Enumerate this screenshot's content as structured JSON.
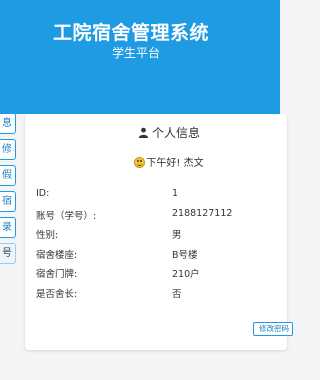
{
  "header": {
    "title": "工院宿舍管理系统",
    "subtitle": "学生平台",
    "color": "#1e9be2"
  },
  "sidebar": {
    "items": [
      {
        "label": "息"
      },
      {
        "label": "修"
      },
      {
        "label": "假"
      },
      {
        "label": "宿"
      },
      {
        "label": "录"
      },
      {
        "label": "号"
      }
    ]
  },
  "card": {
    "title": "个人信息",
    "title_icon": "user-icon",
    "greeting": "下午好!  杰文",
    "greeting_icon": "smile-icon",
    "fields": [
      {
        "label": "ID:",
        "value": "1"
      },
      {
        "label": "账号（学号）:",
        "value": "2188127112"
      },
      {
        "label": "性别:",
        "value": "男"
      },
      {
        "label": "宿舍楼座:",
        "value": "B号楼"
      },
      {
        "label": "宿舍门牌:",
        "value": "210户"
      },
      {
        "label": "是否舍长:",
        "value": "否"
      }
    ],
    "edit_label": "修改密码"
  }
}
